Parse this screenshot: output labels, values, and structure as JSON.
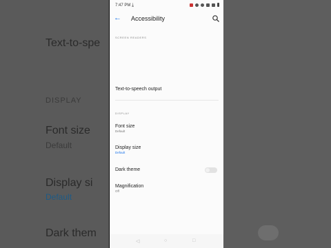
{
  "status_bar": {
    "time": "7:47 PM",
    "icons": [
      "download-icon",
      "media-icon",
      "eye-icon",
      "sync-icon",
      "signal-icon",
      "wifi-icon",
      "battery-icon"
    ]
  },
  "app_bar": {
    "title": "Accessibility"
  },
  "sections": {
    "screen_readers": {
      "header": "SCREEN READERS"
    },
    "tts": {
      "label": "Text-to-speech output"
    },
    "display": {
      "header": "DISPLAY"
    }
  },
  "items": {
    "font_size": {
      "title": "Font size",
      "value": "Default"
    },
    "display_size": {
      "title": "Display size",
      "value": "Default"
    },
    "dark_theme": {
      "title": "Dark theme",
      "state": "off"
    },
    "magnification": {
      "title": "Magnification",
      "value": "Off"
    }
  },
  "background_text": {
    "tts": "Text-to-spe",
    "display": "DISPLAY",
    "font_size": "Font size",
    "font_default": "Default",
    "display_size": "Display si",
    "display_default": "Default",
    "dark_theme": "Dark them"
  },
  "nav_bar": [
    "back-nav",
    "home-nav",
    "recents-nav"
  ],
  "colors": {
    "accent": "#1a73e8",
    "screen_bg": "#fbfbfb",
    "side_bg": "#5a5a5a"
  }
}
